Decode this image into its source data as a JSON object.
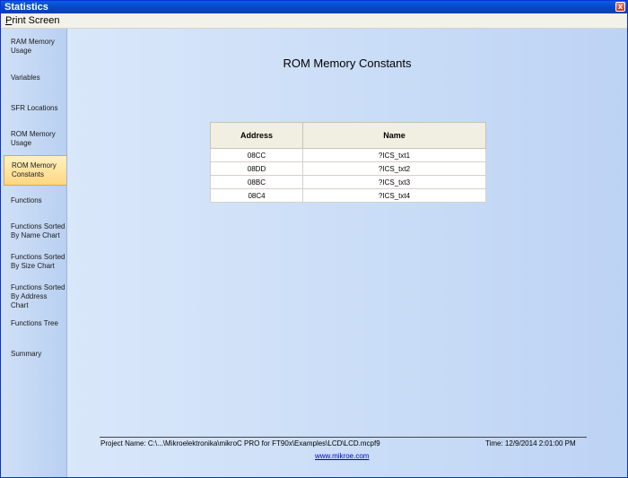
{
  "window": {
    "title": "Statistics",
    "close_glyph": "x"
  },
  "menu": {
    "print_screen_accel": "P",
    "print_screen_rest": "rint Screen"
  },
  "sidebar": {
    "items": [
      {
        "line1": "RAM Memory",
        "line2": "Usage"
      },
      {
        "line1": "Variables",
        "line2": ""
      },
      {
        "line1": "SFR Locations",
        "line2": ""
      },
      {
        "line1": "ROM Memory",
        "line2": "Usage"
      },
      {
        "line1": "ROM Memory",
        "line2": "Constants"
      },
      {
        "line1": "Functions",
        "line2": ""
      },
      {
        "line1": "Functions Sorted",
        "line2": "By Name Chart"
      },
      {
        "line1": "Functions Sorted",
        "line2": "By Size Chart"
      },
      {
        "line1": "Functions Sorted",
        "line2": "By Address Chart"
      },
      {
        "line1": "Functions Tree",
        "line2": ""
      },
      {
        "line1": "Summary",
        "line2": ""
      }
    ],
    "active_index": 4
  },
  "main": {
    "title": "ROM Memory Constants",
    "table": {
      "headers": [
        "Address",
        "Name"
      ],
      "rows": [
        [
          "08CC",
          "?ICS_txt1"
        ],
        [
          "08DD",
          "?ICS_txt2"
        ],
        [
          "08BC",
          "?ICS_txt3"
        ],
        [
          "08C4",
          "?ICS_txt4"
        ]
      ]
    }
  },
  "footer": {
    "project": "Project Name: C:\\...\\Mikroelektronika\\mikroC PRO for FT90x\\Examples\\LCD\\LCD.mcpf9",
    "time": "Time: 12/9/2014 2:01:00 PM",
    "link": "www.mikroe.com"
  },
  "colors": {
    "titlebar": "#0548c9",
    "active_item": "#ffd680",
    "link": "#0000cc"
  }
}
